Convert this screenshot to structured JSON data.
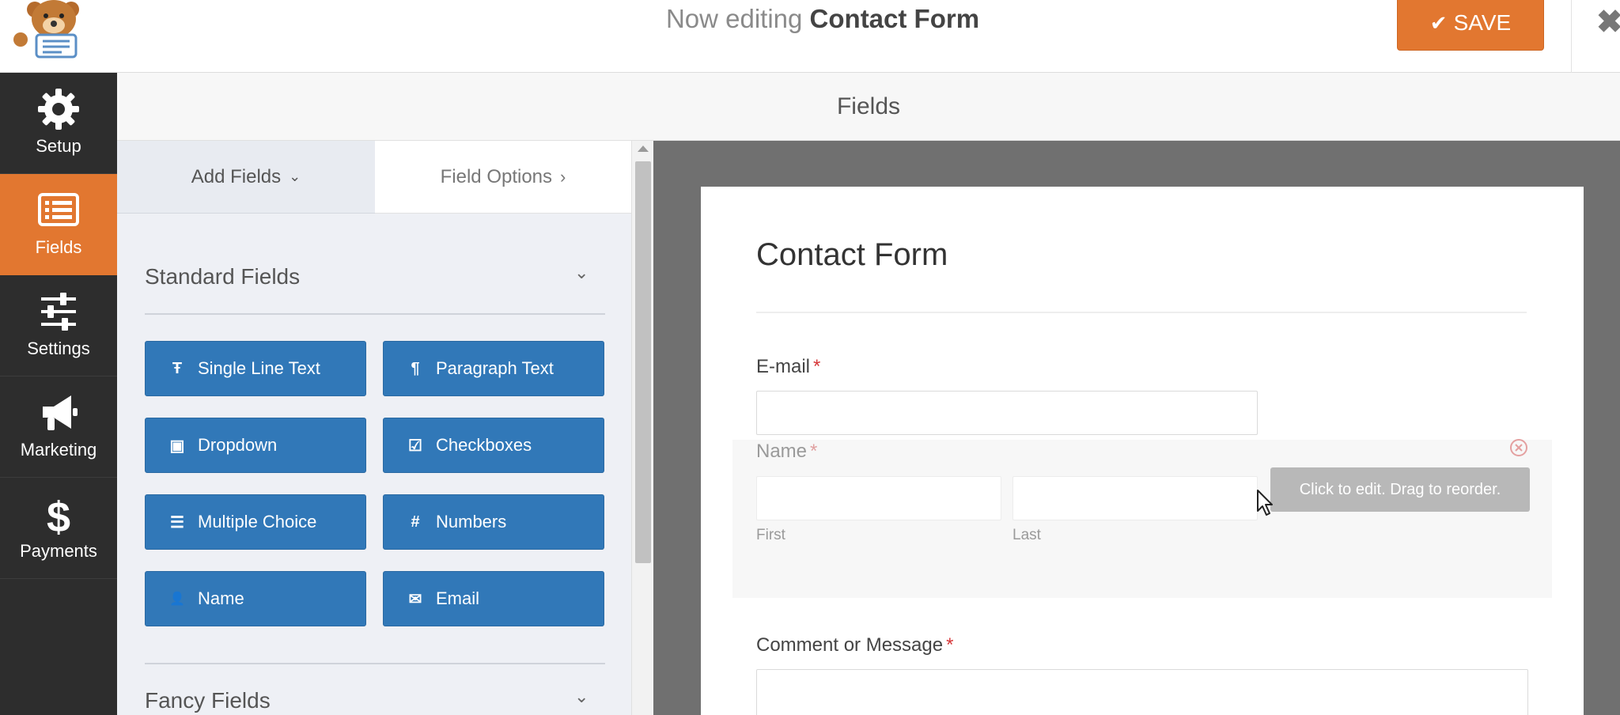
{
  "header": {
    "title_prefix": "Now editing",
    "title_name": "Contact Form",
    "save_label": "SAVE",
    "save_icon": "check-icon",
    "close_icon": "close-icon",
    "logo_icon": "bear-mascot-logo"
  },
  "sidebar": {
    "items": [
      {
        "label": "Setup",
        "icon": "gear-icon",
        "active": false
      },
      {
        "label": "Fields",
        "icon": "list-icon",
        "active": true
      },
      {
        "label": "Settings",
        "icon": "sliders-icon",
        "active": false
      },
      {
        "label": "Marketing",
        "icon": "megaphone-icon",
        "active": false
      },
      {
        "label": "Payments",
        "icon": "dollar-icon",
        "active": false
      }
    ]
  },
  "page": {
    "section_title": "Fields"
  },
  "panel": {
    "tabs": [
      {
        "label": "Add Fields",
        "icon": "chevron-down-icon"
      },
      {
        "label": "Field Options",
        "icon": "chevron-right-icon"
      }
    ],
    "standard_section_title": "Standard Fields",
    "standard_fields": [
      {
        "label": "Single Line Text",
        "icon": "text-t-icon",
        "glyph": "Ŧ"
      },
      {
        "label": "Paragraph Text",
        "icon": "paragraph-icon",
        "glyph": "¶"
      },
      {
        "label": "Dropdown",
        "icon": "dropdown-icon",
        "glyph": "▣"
      },
      {
        "label": "Checkboxes",
        "icon": "checkbox-icon",
        "glyph": "☑"
      },
      {
        "label": "Multiple Choice",
        "icon": "list-icon",
        "glyph": "☰"
      },
      {
        "label": "Numbers",
        "icon": "hash-icon",
        "glyph": "#"
      },
      {
        "label": "Name",
        "icon": "user-icon",
        "glyph": "👤"
      },
      {
        "label": "Email",
        "icon": "envelope-icon",
        "glyph": "✉"
      }
    ],
    "fancy_section_title": "Fancy Fields"
  },
  "form": {
    "title": "Contact Form",
    "email_label": "E-mail",
    "required_mark": "*",
    "name_label": "Name",
    "first_label": "First",
    "last_label": "Last",
    "comment_label": "Comment or Message",
    "tooltip": "Click to edit. Drag to reorder.",
    "delete_icon": "delete-circle-icon"
  },
  "colors": {
    "accent_orange": "#e27730",
    "field_button_blue": "#3178b8",
    "sidebar_dark": "#2d2d2d",
    "required_red": "#d63638"
  }
}
